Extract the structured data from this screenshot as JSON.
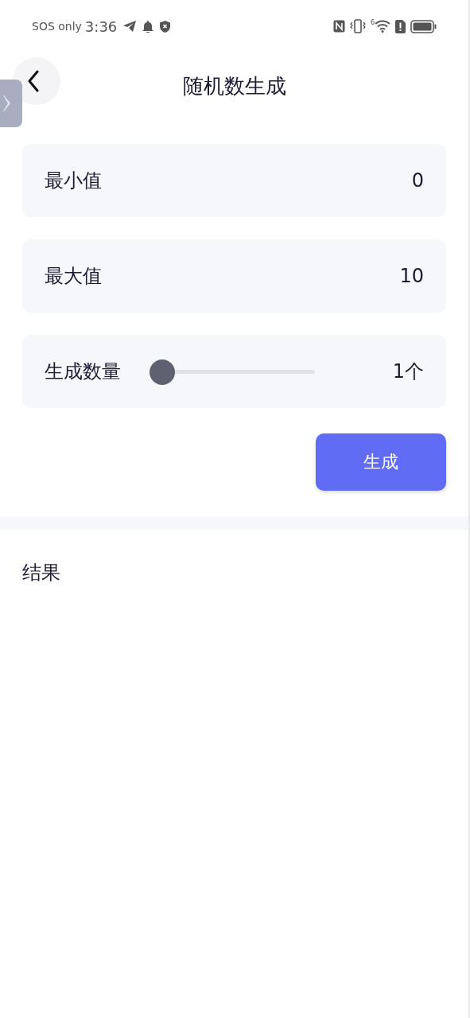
{
  "status_bar": {
    "carrier": "SOS only",
    "time": "3:36",
    "network": "6"
  },
  "header": {
    "title": "随机数生成"
  },
  "fields": [
    {
      "kind": "value",
      "label": "最小值",
      "value": "0"
    },
    {
      "kind": "value",
      "label": "最大值",
      "value": "10"
    },
    {
      "kind": "slider",
      "label": "生成数量",
      "level": 0,
      "value": "1个"
    }
  ],
  "generate_button": "生成",
  "result": {
    "label": "结果"
  }
}
